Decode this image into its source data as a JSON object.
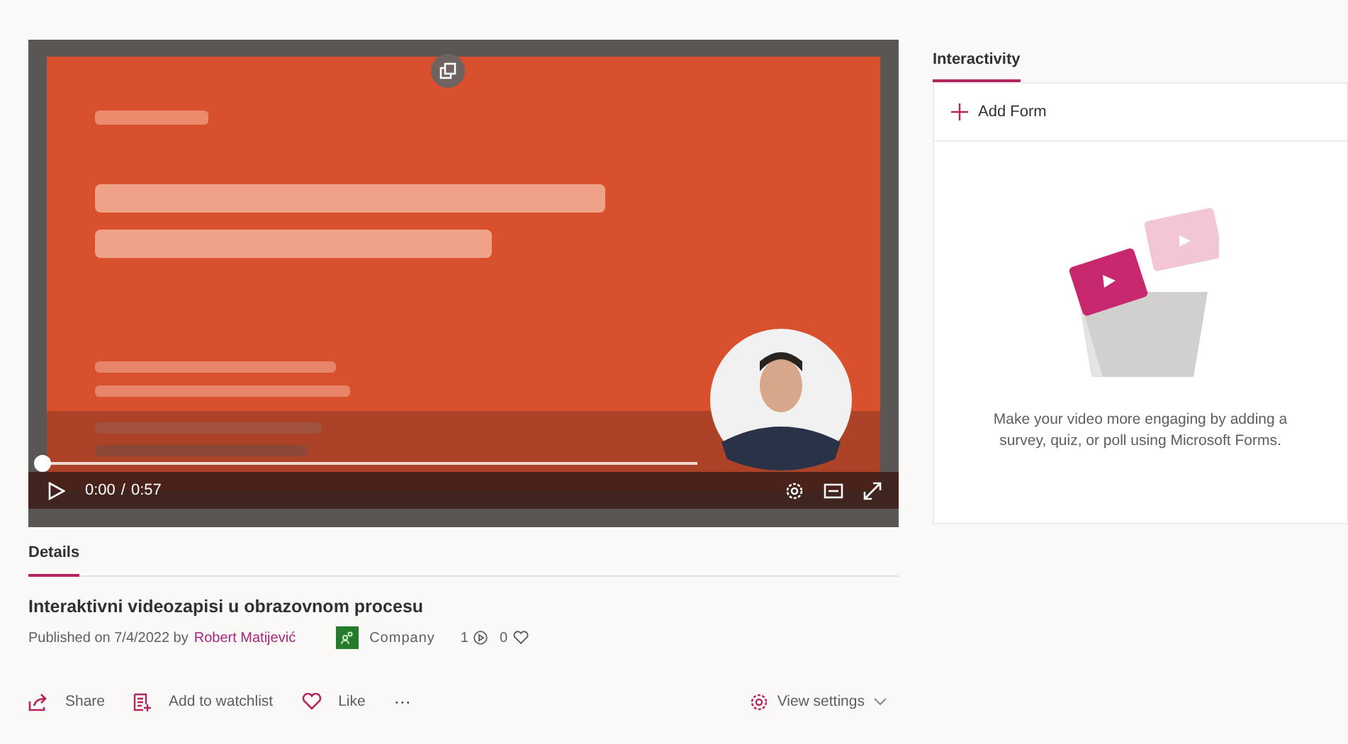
{
  "player": {
    "progress": {
      "level": 0
    },
    "time": {
      "current": "0:00",
      "separator": "/",
      "duration": "0:57"
    }
  },
  "details": {
    "tabs": [
      {
        "label": "Details",
        "selected": true
      }
    ],
    "title": "Interaktivni videozapisi u obrazovnom procesu",
    "published": "Published on 7/4/2022 by",
    "author": "Robert Matijević",
    "audience": "Company",
    "views": "1",
    "likes": "0",
    "actions": [
      {
        "kind": "share",
        "label": "Share"
      },
      {
        "kind": "watchlist",
        "label": "Add to watchlist"
      },
      {
        "kind": "like",
        "label": "Like"
      },
      {
        "kind": "more",
        "label": "···"
      }
    ],
    "view_settings": "View settings"
  },
  "interactivity": {
    "tabs": [
      {
        "label": "Interactivity",
        "selected": true
      }
    ],
    "add_form": "Add Form",
    "message": "Make your video more engaging by adding a survey, quiz, or poll using Microsoft Forms."
  }
}
